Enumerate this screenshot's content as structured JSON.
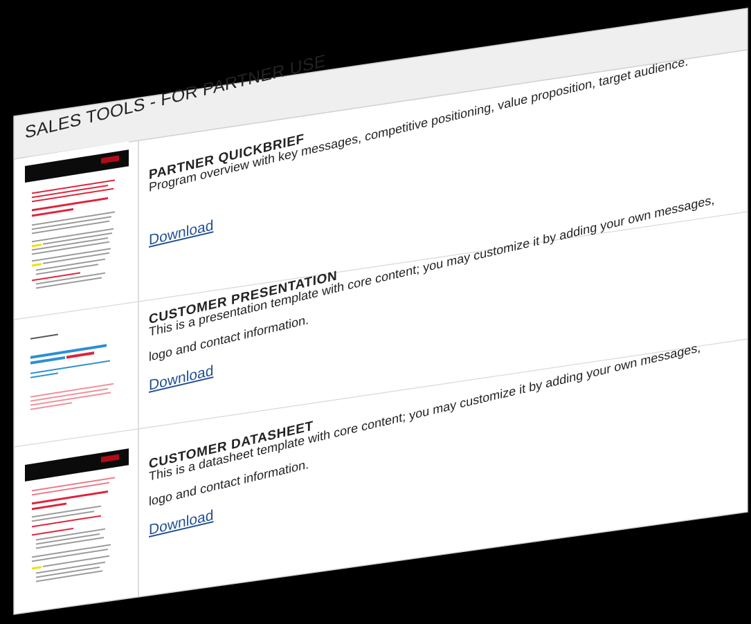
{
  "section": {
    "title": "SALES TOOLS - FOR PARTNER USE"
  },
  "items": [
    {
      "title": "PARTNER QUICKBRIEF",
      "description": "Program overview with key messages, competitive positioning, value proposition, target audience.",
      "link": "Download"
    },
    {
      "title": "CUSTOMER PRESENTATION",
      "description": "This is a presentation template with core content; you may customize it by adding your own messages, logo and contact information.",
      "link": "Download"
    },
    {
      "title": "CUSTOMER DATASHEET",
      "description": "This is a datasheet template with core content; you may customize it by adding your own messages, logo and contact information.",
      "link": "Download"
    }
  ],
  "colors": {
    "link": "#1f4f96",
    "accent_red": "#e0223a",
    "accent_blue": "#2a8fd6"
  }
}
